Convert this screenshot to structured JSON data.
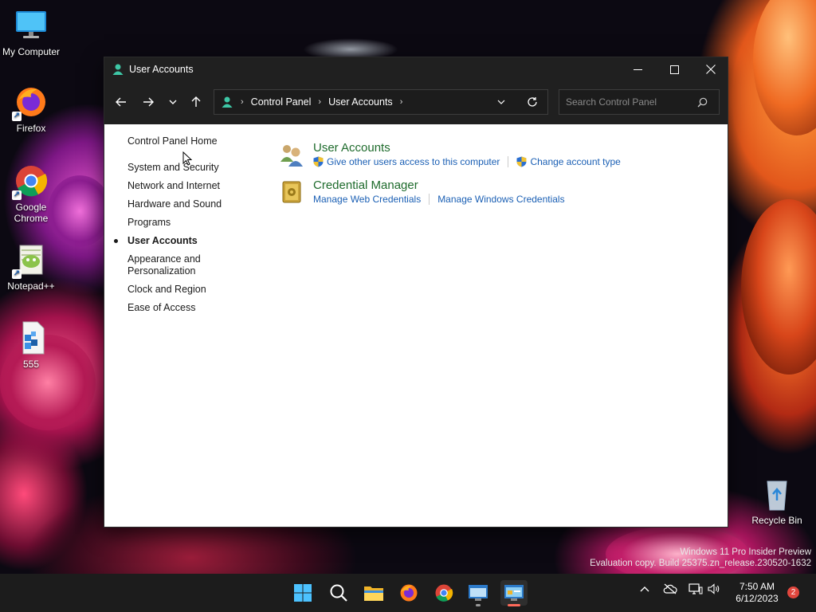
{
  "desktop": {
    "icons": [
      {
        "label": "My Computer"
      },
      {
        "label": "Firefox"
      },
      {
        "label": "Google Chrome"
      },
      {
        "label": "Notepad++"
      },
      {
        "label": "555"
      },
      {
        "label": "Recycle Bin"
      }
    ],
    "watermark": {
      "line1": "Windows 11 Pro Insider Preview",
      "line2": "Evaluation copy. Build 25375.zn_release.230520-1632"
    }
  },
  "window": {
    "title": "User Accounts",
    "address": {
      "crumbs": [
        "Control Panel",
        "User Accounts"
      ]
    },
    "search": {
      "placeholder": "Search Control Panel"
    },
    "leftnav": [
      {
        "label": "Control Panel Home"
      },
      {
        "label": "System and Security"
      },
      {
        "label": "Network and Internet"
      },
      {
        "label": "Hardware and Sound"
      },
      {
        "label": "Programs"
      },
      {
        "label": "User Accounts",
        "current": true
      },
      {
        "label": "Appearance and Personalization"
      },
      {
        "label": "Clock and Region"
      },
      {
        "label": "Ease of Access"
      }
    ],
    "categories": [
      {
        "title": "User Accounts",
        "links": [
          "Give other users access to this computer",
          "Change account type"
        ]
      },
      {
        "title": "Credential Manager",
        "links": [
          "Manage Web Credentials",
          "Manage Windows Credentials"
        ]
      }
    ]
  },
  "taskbar": {
    "time": "7:50 AM",
    "date": "6/12/2023",
    "notification_count": "2"
  }
}
